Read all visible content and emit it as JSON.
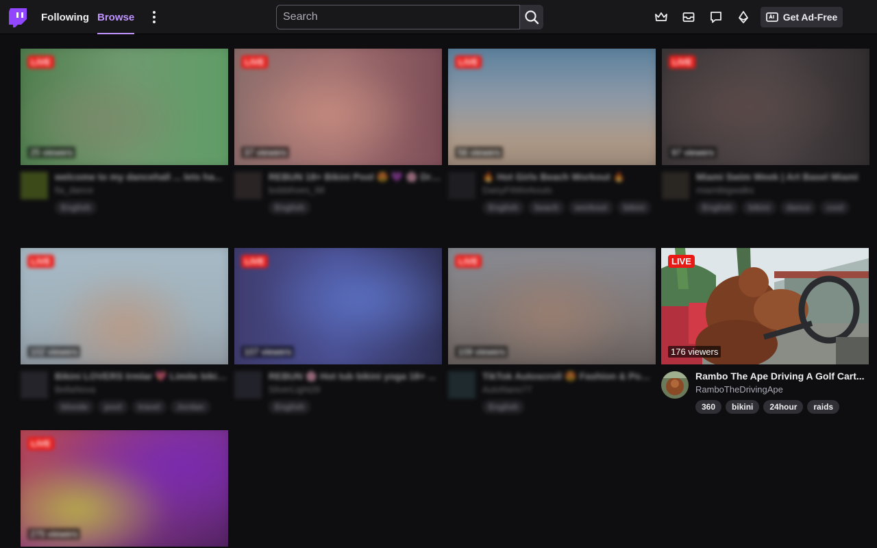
{
  "nav": {
    "following": "Following",
    "browse": "Browse",
    "search_placeholder": "Search",
    "get_ad_free": "Get Ad-Free"
  },
  "accent_color": "#bf94ff",
  "live_color": "#e91916",
  "streams": [
    {
      "live": "LIVE",
      "viewers": "25 viewers",
      "title": "welcome to my dancehall ... lets ha...",
      "channel": "fia_dance",
      "tags": [
        "English"
      ]
    },
    {
      "live": "LIVE",
      "viewers": "37 viewers",
      "title": "REBUN 18+ Bikini Pool 😍 💜 🌸 Dre...",
      "channel": "bobbihoes_98",
      "tags": [
        "English"
      ]
    },
    {
      "live": "LIVE",
      "viewers": "56 viewers",
      "title": "🔥 Hot Girls Beach Workout 🔥",
      "channel": "DaisyFitWorkouts",
      "tags": [
        "English",
        "beach",
        "workout",
        "bikini"
      ]
    },
    {
      "live": "LIVE",
      "viewers": "97 viewers",
      "title": "Miami Swim Week | Art Basel Miami",
      "channel": "miamibigwalks",
      "tags": [
        "English",
        "bikini",
        "dance",
        "cool"
      ]
    },
    {
      "live": "LIVE",
      "viewers": "102 viewers",
      "title": "Bikini LOVERS Irmlar 💖 Limite bikini...",
      "channel": "BellaNova",
      "tags": [
        "blonde",
        "pool",
        "travel",
        "Jordan"
      ]
    },
    {
      "live": "LIVE",
      "viewers": "107 viewers",
      "title": "REBUN 🌸 Hot tub bikini yoga 18+ ...",
      "channel": "SilverLight29",
      "tags": [
        "English"
      ]
    },
    {
      "live": "LIVE",
      "viewers": "109 viewers",
      "title": "TikTok Autoscroll 😍 Fashion & Pool...",
      "channel": "AutoNano77",
      "tags": [
        "English"
      ]
    },
    {
      "live": "LIVE",
      "viewers": "176 viewers",
      "title": "Rambo The Ape Driving A Golf Cart...",
      "channel": "RamboTheDrivingApe",
      "tags": [
        "360",
        "bikini",
        "24hour",
        "raids"
      ]
    },
    {
      "live": "LIVE",
      "viewers": "275 viewers",
      "title": "",
      "channel": "",
      "tags": []
    }
  ]
}
